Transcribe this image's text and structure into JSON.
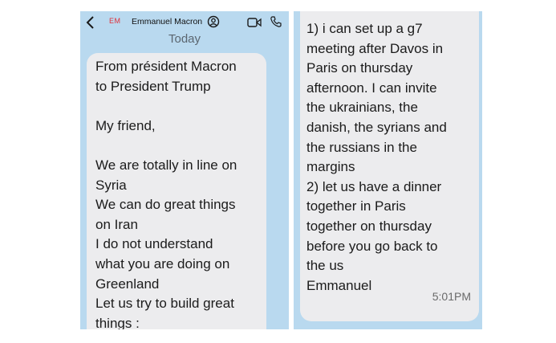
{
  "header": {
    "avatar_initials": "EM",
    "contact_name": "Emmanuel Macron",
    "icons": [
      "chevron-left-icon",
      "person-badge-icon",
      "video-call-icon",
      "phone-icon"
    ]
  },
  "date_separator": "Today",
  "left_message": {
    "text": "From président Macron\nto President Trump\n\nMy friend,\n\nWe are totally in line on\nSyria\nWe can do great things\non Iran\nI do not understand\nwhat you are doing on\nGreenland\nLet us try to build great\nthings :"
  },
  "right_message": {
    "text": "1) i can set up a g7\nmeeting after Davos in\nParis on thursday\nafternoon. I can invite\nthe ukrainians, the\ndanish, the syrians and\nthe russians in the\nmargins\n2) let us have a dinner\ntogether in Paris\ntogether on thursday\nbefore you go back to\nthe us\nEmmanuel",
    "timestamp": "5:01PM"
  },
  "colors": {
    "panel_background": "#b9d9ef",
    "bubble_background": "#ececee",
    "avatar_red": "#e0303a"
  }
}
